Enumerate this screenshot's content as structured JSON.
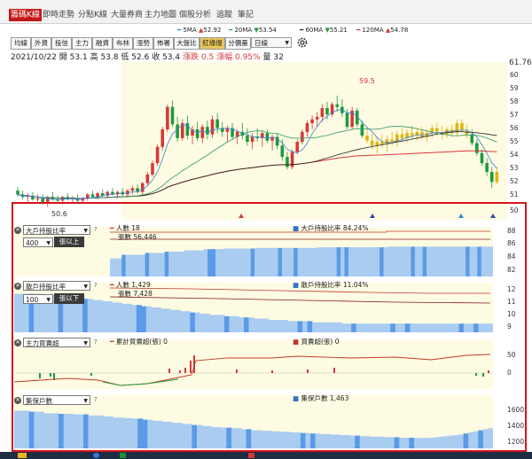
{
  "tabs": [
    {
      "label": "籌碼K線",
      "active": true
    },
    {
      "label": "即時走勢",
      "active": false
    },
    {
      "label": "分點K線",
      "active": false
    },
    {
      "label": "大量券商",
      "active": false
    },
    {
      "label": "主力地圖",
      "active": false
    },
    {
      "label": "個股分析",
      "active": false
    },
    {
      "label": "追蹤",
      "active": false
    },
    {
      "label": "筆記",
      "active": false
    }
  ],
  "ma_legend": [
    {
      "label": "5MA",
      "value": "52.92",
      "dir": "up",
      "color": "#3b7fd6"
    },
    {
      "label": "20MA",
      "value": "53.54",
      "dir": "down",
      "color": "#2a9a6a"
    },
    {
      "label": "60MA",
      "value": "55.21",
      "dir": "down",
      "color": "#222222"
    },
    {
      "label": "120MA",
      "value": "54.78",
      "dir": "up",
      "color": "#d43a3a"
    }
  ],
  "toolbar": [
    "均線",
    "外資",
    "投信",
    "主力",
    "融資",
    "布林",
    "漲勢",
    "佈署",
    "大盤比",
    "紅綠燈",
    "分價量",
    "日線"
  ],
  "price_info": {
    "date": "2021/10/22",
    "open_label": "開",
    "open": "53.1",
    "high_label": "高",
    "high": "53.8",
    "low_label": "低",
    "low": "52.6",
    "close_label": "收",
    "close": "53.4",
    "change_label": "漲跌",
    "change": "0.5",
    "pct_label": "漲幅",
    "pct": "0.95%",
    "vol_label": "量",
    "vol": "32"
  },
  "price_axis": {
    "current": "61.76",
    "ticks": [
      "60",
      "59",
      "58",
      "57",
      "56",
      "55",
      "54",
      "53",
      "52",
      "51",
      "50"
    ]
  },
  "annotations": {
    "high": "59.5",
    "low": "50.6"
  },
  "panels": {
    "big_holder": {
      "select": "大戶持股比率",
      "threshold": "400",
      "threshold_btn": "張以上",
      "people": "人數 18",
      "shares": "張數 56,446",
      "ratio": "大戶持股比率 84.24%",
      "axis": [
        "88",
        "86",
        "84",
        "82"
      ]
    },
    "retail_holder": {
      "select": "散戶持股比率",
      "threshold": "100",
      "threshold_btn": "張以下",
      "people": "人數 1,429",
      "shares": "張數 7,428",
      "ratio": "散戶持股比率 11.04%",
      "axis": [
        "12",
        "11",
        "10",
        "9"
      ]
    },
    "main_force": {
      "select": "主力買賣超",
      "cumulative": "累計買賣超(張) 0",
      "net": "買賣超(張) 0",
      "axis": [
        "50",
        "0"
      ]
    },
    "holders": {
      "select": "集保戶數",
      "count": "集保戶數 1,463",
      "axis": [
        "1600",
        "1400",
        "1200"
      ]
    }
  },
  "chart_data": [
    {
      "type": "candlestick",
      "ylim": [
        50,
        61.76
      ],
      "candles": [
        [
          51.9,
          52.2,
          51.4,
          51.6
        ],
        [
          51.6,
          51.9,
          51.2,
          51.4
        ],
        [
          51.4,
          51.7,
          51.0,
          51.5
        ],
        [
          51.5,
          51.8,
          51.1,
          51.2
        ],
        [
          51.2,
          51.6,
          50.9,
          51.3
        ],
        [
          51.3,
          51.6,
          50.8,
          51.0
        ],
        [
          51.0,
          51.5,
          50.6,
          51.4
        ],
        [
          51.4,
          51.8,
          51.1,
          51.2
        ],
        [
          51.2,
          51.5,
          50.9,
          51.1
        ],
        [
          51.1,
          51.5,
          50.8,
          51.4
        ],
        [
          51.4,
          51.7,
          51.1,
          51.2
        ],
        [
          51.2,
          51.5,
          50.9,
          51.3
        ],
        [
          51.3,
          51.6,
          51.0,
          51.1
        ],
        [
          51.1,
          51.4,
          50.9,
          51.3
        ],
        [
          51.3,
          51.7,
          51.1,
          51.6
        ],
        [
          51.6,
          51.9,
          51.3,
          51.4
        ],
        [
          51.4,
          51.8,
          51.2,
          51.7
        ],
        [
          51.7,
          52.0,
          51.4,
          51.5
        ],
        [
          51.5,
          51.9,
          51.3,
          51.8
        ],
        [
          51.8,
          52.1,
          51.5,
          51.6
        ],
        [
          51.6,
          51.9,
          51.3,
          51.8
        ],
        [
          51.8,
          52.1,
          51.5,
          51.6
        ],
        [
          51.6,
          52.0,
          51.4,
          51.9
        ],
        [
          51.9,
          52.3,
          51.6,
          52.1
        ],
        [
          52.1,
          52.4,
          51.7,
          51.8
        ],
        [
          51.8,
          52.6,
          51.6,
          52.5
        ],
        [
          52.5,
          53.4,
          52.3,
          53.2
        ],
        [
          53.2,
          54.3,
          53.0,
          54.1
        ],
        [
          54.1,
          55.6,
          53.9,
          55.4
        ],
        [
          55.4,
          57.0,
          55.1,
          56.8
        ],
        [
          56.8,
          58.8,
          56.6,
          58.6
        ],
        [
          58.6,
          59.1,
          57.0,
          57.2
        ],
        [
          57.2,
          57.8,
          55.8,
          56.1
        ],
        [
          56.1,
          57.6,
          55.9,
          57.3
        ],
        [
          57.3,
          57.9,
          56.0,
          56.3
        ],
        [
          56.3,
          57.1,
          55.6,
          56.8
        ],
        [
          56.8,
          57.4,
          55.9,
          56.1
        ],
        [
          56.1,
          57.2,
          55.7,
          57.0
        ],
        [
          57.0,
          57.5,
          56.0,
          56.4
        ],
        [
          56.4,
          57.9,
          56.1,
          57.6
        ],
        [
          57.6,
          58.1,
          56.5,
          56.9
        ],
        [
          56.9,
          57.4,
          56.2,
          56.6
        ],
        [
          56.6,
          57.1,
          55.8,
          56.9
        ],
        [
          56.9,
          57.3,
          56.0,
          56.2
        ],
        [
          56.2,
          56.8,
          55.6,
          56.6
        ],
        [
          56.6,
          57.3,
          56.0,
          56.3
        ],
        [
          56.3,
          56.9,
          55.5,
          55.8
        ],
        [
          55.8,
          56.5,
          55.2,
          56.2
        ],
        [
          56.2,
          56.9,
          55.8,
          56.1
        ],
        [
          56.1,
          56.7,
          55.4,
          56.5
        ],
        [
          56.5,
          56.8,
          55.7,
          55.9
        ],
        [
          55.9,
          56.4,
          55.1,
          56.2
        ],
        [
          56.2,
          56.5,
          55.2,
          55.5
        ],
        [
          55.5,
          56.0,
          54.3,
          54.6
        ],
        [
          54.6,
          55.0,
          53.6,
          53.8
        ],
        [
          53.8,
          55.2,
          53.6,
          55.0
        ],
        [
          55.0,
          56.0,
          54.8,
          55.8
        ],
        [
          55.8,
          56.8,
          55.6,
          56.6
        ],
        [
          56.6,
          57.5,
          56.2,
          57.3
        ],
        [
          57.3,
          57.9,
          56.8,
          57.6
        ],
        [
          57.6,
          58.2,
          57.0,
          57.8
        ],
        [
          57.8,
          58.8,
          57.4,
          58.5
        ],
        [
          58.5,
          59.0,
          57.6,
          58.0
        ],
        [
          58.0,
          59.0,
          57.8,
          58.8
        ],
        [
          58.8,
          59.5,
          58.2,
          58.6
        ],
        [
          58.6,
          59.2,
          57.8,
          58.1
        ],
        [
          58.1,
          58.4,
          56.8,
          57.0
        ],
        [
          57.0,
          58.6,
          56.8,
          58.3
        ],
        [
          58.3,
          58.5,
          57.0,
          57.2
        ],
        [
          57.2,
          57.5,
          56.1,
          56.3
        ],
        [
          56.3,
          57.0,
          55.7,
          55.9
        ],
        [
          55.9,
          56.5,
          55.2,
          55.5
        ],
        [
          55.5,
          56.2,
          54.9,
          55.8
        ],
        [
          55.8,
          56.4,
          55.3,
          55.6
        ],
        [
          55.6,
          56.3,
          55.0,
          56.0
        ],
        [
          56.0,
          56.6,
          55.5,
          55.8
        ],
        [
          55.8,
          56.7,
          55.4,
          56.4
        ],
        [
          56.4,
          56.9,
          55.9,
          56.1
        ],
        [
          56.1,
          56.8,
          55.7,
          56.5
        ],
        [
          56.5,
          57.1,
          56.1,
          56.3
        ],
        [
          56.3,
          56.9,
          55.9,
          56.6
        ],
        [
          56.6,
          57.0,
          56.0,
          56.2
        ],
        [
          56.2,
          56.8,
          55.8,
          56.5
        ],
        [
          56.5,
          57.2,
          56.1,
          56.9
        ],
        [
          56.9,
          57.3,
          56.3,
          56.6
        ],
        [
          56.6,
          57.1,
          56.0,
          56.4
        ],
        [
          56.4,
          57.0,
          56.1,
          56.8
        ],
        [
          56.8,
          57.2,
          56.2,
          56.5
        ],
        [
          56.5,
          57.6,
          56.2,
          57.3
        ],
        [
          57.3,
          57.6,
          56.5,
          56.7
        ],
        [
          56.7,
          57.2,
          56.1,
          56.4
        ],
        [
          56.4,
          56.8,
          55.5,
          55.7
        ],
        [
          55.7,
          56.0,
          54.7,
          54.9
        ],
        [
          54.9,
          55.2,
          53.9,
          54.1
        ],
        [
          54.1,
          54.5,
          53.1,
          53.4
        ],
        [
          53.4,
          53.8,
          52.1,
          52.6
        ],
        [
          52.6,
          53.8,
          52.4,
          53.4
        ]
      ]
    },
    {
      "type": "bar",
      "name": "大戶持股比率",
      "ylim": [
        81,
        89
      ],
      "values": [
        83.9,
        83.9,
        83.9,
        84.5,
        84.5,
        84.5,
        84.5,
        84.5,
        84.5,
        84.8,
        84.8,
        84.8,
        84.8,
        84.8,
        85.0,
        85.0,
        85.0,
        85.0,
        85.0,
        85.2,
        85.2,
        85.2,
        85.2,
        85.2,
        85.4,
        85.4,
        85.4,
        85.4,
        85.4,
        85.5,
        85.5,
        85.5,
        85.5,
        85.5,
        85.5,
        85.5,
        85.5,
        85.6,
        85.6,
        85.6,
        85.6,
        85.6,
        85.6,
        85.6,
        85.6,
        85.6,
        85.6,
        85.6,
        85.6,
        85.6,
        85.6,
        85.6,
        85.6,
        85.7,
        85.7,
        85.7,
        85.7,
        85.7,
        85.7,
        85.7,
        85.7,
        85.7,
        85.7,
        85.7,
        85.7,
        85.7,
        85.7,
        85.7,
        85.7,
        85.7,
        85.7,
        85.8,
        85.8,
        85.8,
        85.8,
        85.8,
        85.8,
        85.8,
        85.8,
        85.8,
        85.8,
        85.8,
        85.8,
        85.8,
        85.8,
        85.8,
        85.8,
        85.8,
        85.8,
        85.8,
        85.8,
        85.8,
        85.8,
        85.8,
        85.8,
        85.8,
        85.8,
        85.8
      ]
    },
    {
      "type": "bar",
      "name": "散戶持股比率",
      "ylim": [
        8.6,
        12.6
      ],
      "values": [
        11.7,
        11.7,
        11.7,
        11.7,
        11.7,
        11.7,
        11.6,
        11.6,
        11.6,
        11.6,
        11.5,
        11.5,
        11.4,
        11.4,
        11.3,
        11.3,
        11.2,
        11.2,
        11.1,
        11.1,
        11.0,
        11.0,
        10.9,
        10.9,
        10.8,
        10.8,
        10.7,
        10.7,
        10.6,
        10.6,
        10.5,
        10.5,
        10.4,
        10.4,
        10.3,
        10.3,
        10.2,
        10.2,
        10.1,
        10.1,
        10.0,
        10.0,
        10.0,
        9.9,
        9.9,
        9.9,
        9.8,
        9.8,
        9.8,
        9.7,
        9.7,
        9.7,
        9.6,
        9.6,
        9.6,
        9.6,
        9.5,
        9.5,
        9.5,
        9.5,
        9.5,
        9.4,
        9.4,
        9.4,
        9.4,
        9.4,
        9.4,
        9.3,
        9.3,
        9.3,
        9.3,
        9.3,
        9.3,
        9.3,
        9.3,
        9.3,
        9.3,
        9.3,
        9.3,
        9.3,
        9.3,
        9.3,
        9.3,
        9.3,
        9.3,
        9.3,
        9.3,
        9.3,
        9.3,
        9.3,
        9.3,
        9.3,
        9.3,
        9.3,
        9.3,
        9.3,
        9.3,
        9.3
      ]
    },
    {
      "type": "bar",
      "name": "集保戶數",
      "ylim": [
        1150,
        1650
      ],
      "values": [
        1505,
        1505,
        1505,
        1495,
        1495,
        1495,
        1480,
        1480,
        1480,
        1475,
        1475,
        1475,
        1470,
        1470,
        1470,
        1460,
        1460,
        1460,
        1450,
        1450,
        1440,
        1440,
        1435,
        1435,
        1430,
        1430,
        1420,
        1420,
        1410,
        1410,
        1400,
        1400,
        1390,
        1390,
        1380,
        1380,
        1370,
        1370,
        1360,
        1360,
        1350,
        1350,
        1345,
        1345,
        1340,
        1340,
        1330,
        1330,
        1320,
        1320,
        1315,
        1315,
        1310,
        1310,
        1305,
        1305,
        1300,
        1300,
        1295,
        1295,
        1290,
        1290,
        1285,
        1285,
        1280,
        1280,
        1275,
        1275,
        1270,
        1270,
        1265,
        1265,
        1260,
        1260,
        1260,
        1255,
        1255,
        1255,
        1250,
        1250,
        1250,
        1248,
        1248,
        1248,
        1250,
        1255,
        1260,
        1265,
        1270,
        1275,
        1280,
        1290,
        1300,
        1310,
        1320,
        1330,
        1340
      ]
    }
  ]
}
